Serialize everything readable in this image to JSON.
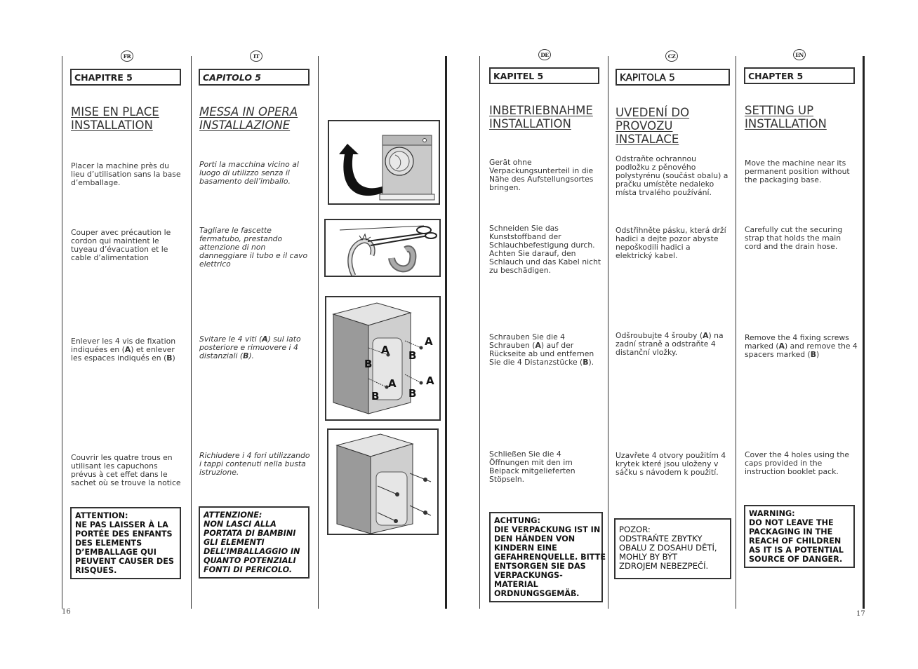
{
  "pages": {
    "left_page_number": "16",
    "right_page_number": "17"
  },
  "columns": {
    "fr": {
      "lang_badge": "FR",
      "chapter": "CHAPITRE 5",
      "title_line1": "MISE EN PLACE",
      "title_line2": "INSTALLATION",
      "step1": "Placer la machine près du lieu d’utilisation sans la base d’emballage.",
      "step2": "Couper avec précaution le cordon qui maintient le tuyeau d’évacuation et le cable d’alimentation",
      "step3_pre": "Enlever les 4 vis de fixation indiquées en (",
      "step3_a": "A",
      "step3_mid": ") et enlever les espaces indiqués en (",
      "step3_b": "B",
      "step3_post": ")",
      "step4": "Couvrir les quatre trous en utilisant les capuchons prévus à cet effet dans le sachet où se trouve la notice",
      "warning_lines": [
        "ATTENTION:",
        "NE PAS LAISSER À LA",
        "PORTÉE DES ENFANTS",
        "DES ELEMENTS",
        "D’EMBALLAGE QUI",
        "PEUVENT CAUSER DES",
        "RISQUES."
      ]
    },
    "it": {
      "lang_badge": "IT",
      "chapter": "CAPITOLO 5",
      "title_line1": "MESSA IN OPERA",
      "title_line2": "INSTALLAZIONE",
      "step1": "Porti la macchina vicino al luogo di utilizzo senza il basamento dell’imballo.",
      "step2": "Tagliare le fascette fermatubo, prestando attenzione di non danneggiare il tubo e il cavo elettrico",
      "step3_pre": "Svitare le 4 viti (",
      "step3_a": "A",
      "step3_mid": ") sul lato posteriore e rimuovere i 4 distanziali (",
      "step3_b": "B",
      "step3_post": ").",
      "step4": "Richiudere i 4 fori utilizzando i tappi contenuti nella busta istruzione.",
      "warning_lines": [
        "ATTENZIONE:",
        "NON LASCI ALLA",
        "PORTATA DI BAMBINI",
        "GLI ELEMENTI",
        "DELL’IMBALLAGGIO IN",
        "QUANTO POTENZIALI",
        "FONTI DI PERICOLO."
      ]
    },
    "de": {
      "lang_badge": "DE",
      "chapter": "KAPITEL 5",
      "title_line1": "INBETRIEBNAHME",
      "title_line2": "INSTALLATION",
      "step1": "Gerät ohne Verpackungsunterteil in die Nähe des Aufstellungsortes bringen.",
      "step2": "Schneiden Sie das Kunststoffband der Schlauchbefestigung durch. Achten Sie darauf, den Schlauch und das Kabel nicht zu beschädigen.",
      "step3_pre": "Schrauben Sie die 4 Schrauben (",
      "step3_a": "A",
      "step3_mid": ") auf der Rückseite ab und entfernen Sie die 4 Distanzstücke (",
      "step3_b": "B",
      "step3_post": ").",
      "step4": "Schließen Sie die 4 Öffnungen mit den im Beipack mitgelieferten Stöpseln.",
      "warning_lines": [
        "ACHTUNG:",
        "DIE VERPACKUNG IST IN",
        "DEN HÄNDEN VON",
        "KINDERN EINE",
        "GEFAHRENQUELLE. BITTE",
        "ENTSORGEN SIE DAS",
        "VERPACKUNGS-",
        "MATERIAL",
        "ORDNUNGSGEMÄß."
      ]
    },
    "cz": {
      "lang_badge": "CZ",
      "chapter": "KAPITOLA 5",
      "title_line1": "UVEDENÍ DO",
      "title_line2": "PROVOZU",
      "title_line3": "INSTALACE",
      "step1": "Odstraňte ochrannou podložku z pěnového polystyrénu (součást obalu) a pračku umístěte nedaleko místa trvalého používání.",
      "step2": "Odstřihněte pásku, která drží hadici a dejte pozor abyste nepoškodili hadici a elektrický kabel.",
      "step3_pre": "Odšroubujte 4 šrouby (",
      "step3_a": "A",
      "step3_mid": ") na zadní straně a odstraňte 4 distanční vložky.",
      "step4": "Uzavřete 4 otvory použitím 4 krytek které jsou uloženy v sáčku s návodem k použití.",
      "warning_lines": [
        "POZOR:",
        "ODSTRAŇTE ZBYTKY",
        "OBALU Z DOSAHU DĚTÍ,",
        "MOHLY BY BÝT",
        "ZDROJEM NEBEZPEČÍ."
      ]
    },
    "en": {
      "lang_badge": "EN",
      "chapter": "CHAPTER 5",
      "title_line1": "SETTING UP",
      "title_line2": "INSTALLATION",
      "step1": "Move the machine near its permanent position without the packaging base.",
      "step2": "Carefully cut the securing strap that holds the main cord and the drain hose.",
      "step3_pre": "Remove the 4 fixing screws marked (",
      "step3_a": "A",
      "step3_mid": ") and remove the 4 spacers marked (",
      "step3_b": "B",
      "step3_post": ")",
      "step4": "Cover the 4 holes using the caps provided in the instruction booklet pack.",
      "warning_lines": [
        "WARNING:",
        "DO NOT LEAVE THE",
        "PACKAGING IN THE",
        "REACH OF CHILDREN",
        "AS IT IS A POTENTIAL",
        "SOURCE OF DANGER."
      ]
    }
  },
  "figures": {
    "fig3_labels": [
      "A",
      "B",
      "A",
      "B",
      "A",
      "B",
      "A",
      "B"
    ]
  }
}
